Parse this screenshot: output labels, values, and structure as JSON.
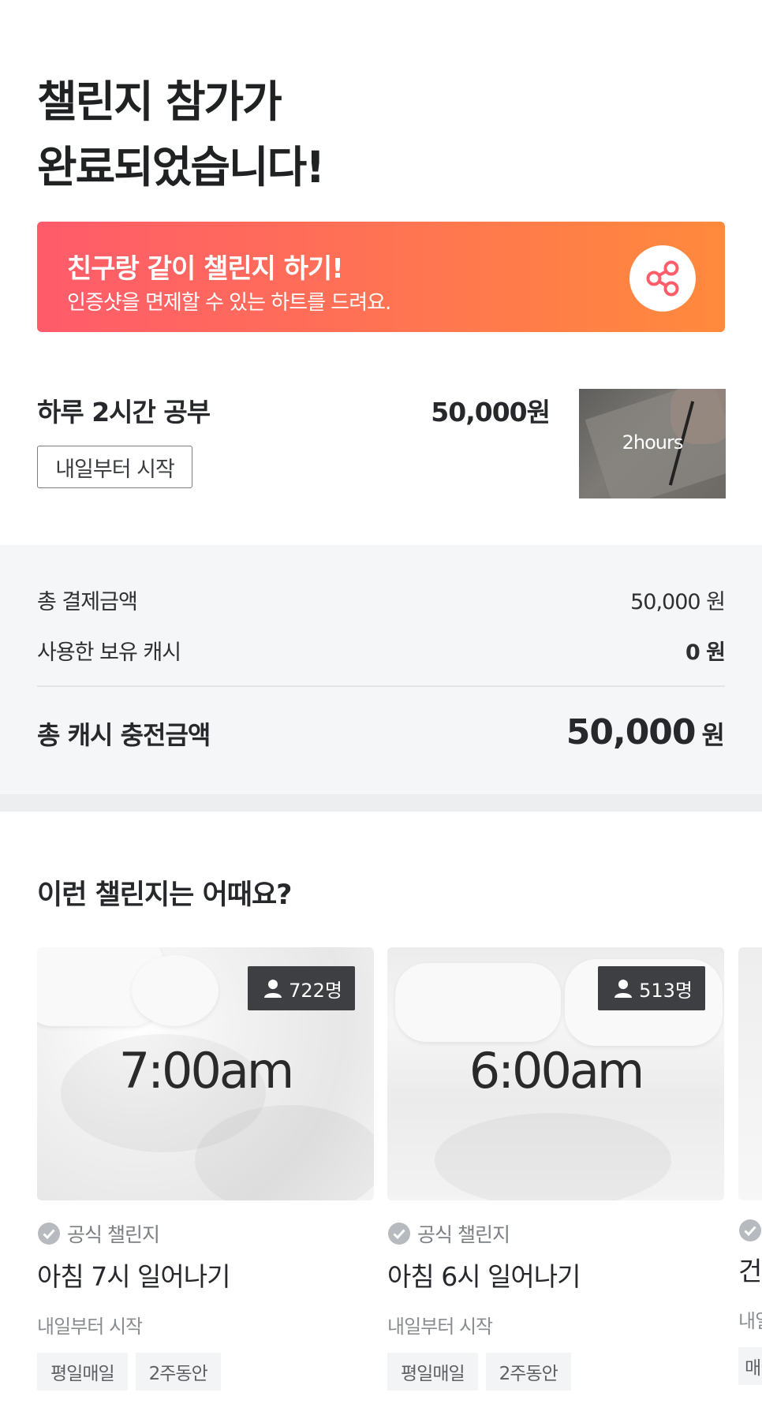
{
  "header": {
    "title_line1": "챌린지 참가가",
    "title_line2": "완료되었습니다!"
  },
  "banner": {
    "title": "친구랑 같이 챌린지 하기!",
    "subtitle": "인증샷을 면제할 수 있는 하트를 드려요.",
    "share_icon": "share-icon",
    "gradient_start": "#ff5b6b",
    "gradient_end": "#ff8a3c"
  },
  "challenge": {
    "name": "하루 2시간 공부",
    "price": "50,000원",
    "start_label": "내일부터 시작",
    "thumbnail_text": "2hours"
  },
  "payment": {
    "total_payment_label": "총 결제금액",
    "total_payment_value": "50,000 원",
    "used_cash_label": "사용한 보유 캐시",
    "used_cash_value": "0 원",
    "total_charge_label": "총 캐시 충전금액",
    "total_charge_amount": "50,000",
    "total_charge_unit": "원"
  },
  "recommend": {
    "title": "이런 챌린지는 어때요?",
    "cards": [
      {
        "time": "7:00am",
        "participants": "722명",
        "official_label": "공식 챌린지",
        "name": "아침 7시 일어나기",
        "start": "내일부터 시작",
        "tags": [
          "평일매일",
          "2주동안"
        ]
      },
      {
        "time": "6:00am",
        "participants": "513명",
        "official_label": "공식 챌린지",
        "name": "아침 6시 일어나기",
        "start": "내일부터 시작",
        "tags": [
          "평일매일",
          "2주동안"
        ]
      }
    ],
    "peek_card": {
      "name": "건",
      "start": "내일",
      "tag": "매"
    }
  }
}
